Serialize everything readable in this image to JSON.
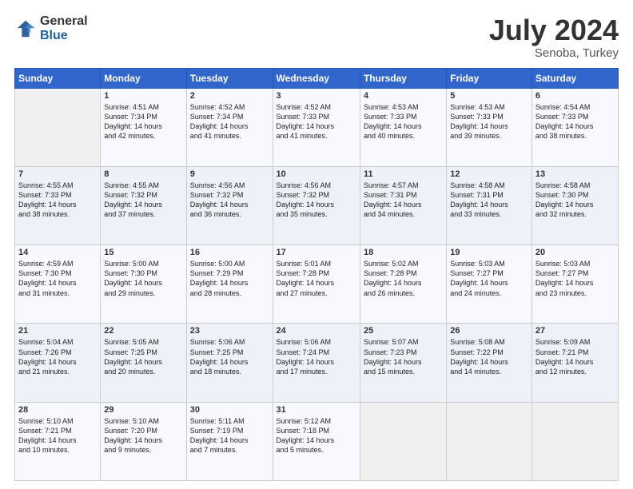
{
  "header": {
    "logo_general": "General",
    "logo_blue": "Blue",
    "month": "July 2024",
    "location": "Senoba, Turkey"
  },
  "weekdays": [
    "Sunday",
    "Monday",
    "Tuesday",
    "Wednesday",
    "Thursday",
    "Friday",
    "Saturday"
  ],
  "weeks": [
    [
      {
        "day": "",
        "info": ""
      },
      {
        "day": "1",
        "info": "Sunrise: 4:51 AM\nSunset: 7:34 PM\nDaylight: 14 hours\nand 42 minutes."
      },
      {
        "day": "2",
        "info": "Sunrise: 4:52 AM\nSunset: 7:34 PM\nDaylight: 14 hours\nand 41 minutes."
      },
      {
        "day": "3",
        "info": "Sunrise: 4:52 AM\nSunset: 7:33 PM\nDaylight: 14 hours\nand 41 minutes."
      },
      {
        "day": "4",
        "info": "Sunrise: 4:53 AM\nSunset: 7:33 PM\nDaylight: 14 hours\nand 40 minutes."
      },
      {
        "day": "5",
        "info": "Sunrise: 4:53 AM\nSunset: 7:33 PM\nDaylight: 14 hours\nand 39 minutes."
      },
      {
        "day": "6",
        "info": "Sunrise: 4:54 AM\nSunset: 7:33 PM\nDaylight: 14 hours\nand 38 minutes."
      }
    ],
    [
      {
        "day": "7",
        "info": "Sunrise: 4:55 AM\nSunset: 7:33 PM\nDaylight: 14 hours\nand 38 minutes."
      },
      {
        "day": "8",
        "info": "Sunrise: 4:55 AM\nSunset: 7:32 PM\nDaylight: 14 hours\nand 37 minutes."
      },
      {
        "day": "9",
        "info": "Sunrise: 4:56 AM\nSunset: 7:32 PM\nDaylight: 14 hours\nand 36 minutes."
      },
      {
        "day": "10",
        "info": "Sunrise: 4:56 AM\nSunset: 7:32 PM\nDaylight: 14 hours\nand 35 minutes."
      },
      {
        "day": "11",
        "info": "Sunrise: 4:57 AM\nSunset: 7:31 PM\nDaylight: 14 hours\nand 34 minutes."
      },
      {
        "day": "12",
        "info": "Sunrise: 4:58 AM\nSunset: 7:31 PM\nDaylight: 14 hours\nand 33 minutes."
      },
      {
        "day": "13",
        "info": "Sunrise: 4:58 AM\nSunset: 7:30 PM\nDaylight: 14 hours\nand 32 minutes."
      }
    ],
    [
      {
        "day": "14",
        "info": "Sunrise: 4:59 AM\nSunset: 7:30 PM\nDaylight: 14 hours\nand 31 minutes."
      },
      {
        "day": "15",
        "info": "Sunrise: 5:00 AM\nSunset: 7:30 PM\nDaylight: 14 hours\nand 29 minutes."
      },
      {
        "day": "16",
        "info": "Sunrise: 5:00 AM\nSunset: 7:29 PM\nDaylight: 14 hours\nand 28 minutes."
      },
      {
        "day": "17",
        "info": "Sunrise: 5:01 AM\nSunset: 7:28 PM\nDaylight: 14 hours\nand 27 minutes."
      },
      {
        "day": "18",
        "info": "Sunrise: 5:02 AM\nSunset: 7:28 PM\nDaylight: 14 hours\nand 26 minutes."
      },
      {
        "day": "19",
        "info": "Sunrise: 5:03 AM\nSunset: 7:27 PM\nDaylight: 14 hours\nand 24 minutes."
      },
      {
        "day": "20",
        "info": "Sunrise: 5:03 AM\nSunset: 7:27 PM\nDaylight: 14 hours\nand 23 minutes."
      }
    ],
    [
      {
        "day": "21",
        "info": "Sunrise: 5:04 AM\nSunset: 7:26 PM\nDaylight: 14 hours\nand 21 minutes."
      },
      {
        "day": "22",
        "info": "Sunrise: 5:05 AM\nSunset: 7:25 PM\nDaylight: 14 hours\nand 20 minutes."
      },
      {
        "day": "23",
        "info": "Sunrise: 5:06 AM\nSunset: 7:25 PM\nDaylight: 14 hours\nand 18 minutes."
      },
      {
        "day": "24",
        "info": "Sunrise: 5:06 AM\nSunset: 7:24 PM\nDaylight: 14 hours\nand 17 minutes."
      },
      {
        "day": "25",
        "info": "Sunrise: 5:07 AM\nSunset: 7:23 PM\nDaylight: 14 hours\nand 15 minutes."
      },
      {
        "day": "26",
        "info": "Sunrise: 5:08 AM\nSunset: 7:22 PM\nDaylight: 14 hours\nand 14 minutes."
      },
      {
        "day": "27",
        "info": "Sunrise: 5:09 AM\nSunset: 7:21 PM\nDaylight: 14 hours\nand 12 minutes."
      }
    ],
    [
      {
        "day": "28",
        "info": "Sunrise: 5:10 AM\nSunset: 7:21 PM\nDaylight: 14 hours\nand 10 minutes."
      },
      {
        "day": "29",
        "info": "Sunrise: 5:10 AM\nSunset: 7:20 PM\nDaylight: 14 hours\nand 9 minutes."
      },
      {
        "day": "30",
        "info": "Sunrise: 5:11 AM\nSunset: 7:19 PM\nDaylight: 14 hours\nand 7 minutes."
      },
      {
        "day": "31",
        "info": "Sunrise: 5:12 AM\nSunset: 7:18 PM\nDaylight: 14 hours\nand 5 minutes."
      },
      {
        "day": "",
        "info": ""
      },
      {
        "day": "",
        "info": ""
      },
      {
        "day": "",
        "info": ""
      }
    ]
  ]
}
